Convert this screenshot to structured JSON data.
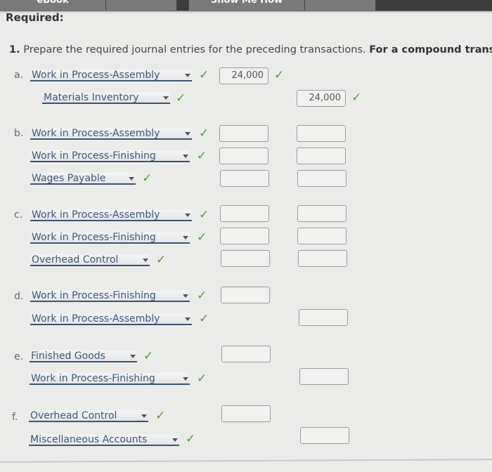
{
  "tabs": [
    {
      "label": "eBook"
    },
    {
      "label": ""
    },
    {
      "label": "Show Me How"
    },
    {
      "label": ""
    }
  ],
  "heading": "Required:",
  "instruction": {
    "number": "1.",
    "text": "Prepare the required journal entries for the preceding transactions.",
    "bold_text": "For a compound transac"
  },
  "check_icon": "✓",
  "entries": [
    {
      "letter": "a.",
      "lines": [
        {
          "account": "Work in Process-Assembly",
          "debit": "24,000",
          "credit": null,
          "debit_correct": true
        },
        {
          "account": "Materials Inventory",
          "debit": null,
          "credit": "24,000",
          "credit_correct": true
        }
      ]
    },
    {
      "letter": "b.",
      "lines": [
        {
          "account": "Work in Process-Assembly",
          "debit": "",
          "credit": ""
        },
        {
          "account": "Work in Process-Finishing",
          "debit": "",
          "credit": ""
        },
        {
          "account": "Wages Payable",
          "debit": "",
          "credit": ""
        }
      ]
    },
    {
      "letter": "c.",
      "lines": [
        {
          "account": "Work in Process-Assembly",
          "debit": "",
          "credit": ""
        },
        {
          "account": "Work in Process-Finishing",
          "debit": "",
          "credit": ""
        },
        {
          "account": "Overhead Control",
          "debit": "",
          "credit": ""
        }
      ]
    },
    {
      "letter": "d.",
      "lines": [
        {
          "account": "Work in Process-Finishing",
          "debit": ""
        },
        {
          "account": "Work in Process-Assembly",
          "credit": ""
        }
      ]
    },
    {
      "letter": "e.",
      "lines": [
        {
          "account": "Finished Goods",
          "debit": ""
        },
        {
          "account": "Work in Process-Finishing",
          "credit": ""
        }
      ]
    },
    {
      "letter": "f.",
      "lines": [
        {
          "account": "Overhead Control",
          "debit": ""
        },
        {
          "account": "Miscellaneous Accounts",
          "credit": ""
        }
      ]
    }
  ]
}
